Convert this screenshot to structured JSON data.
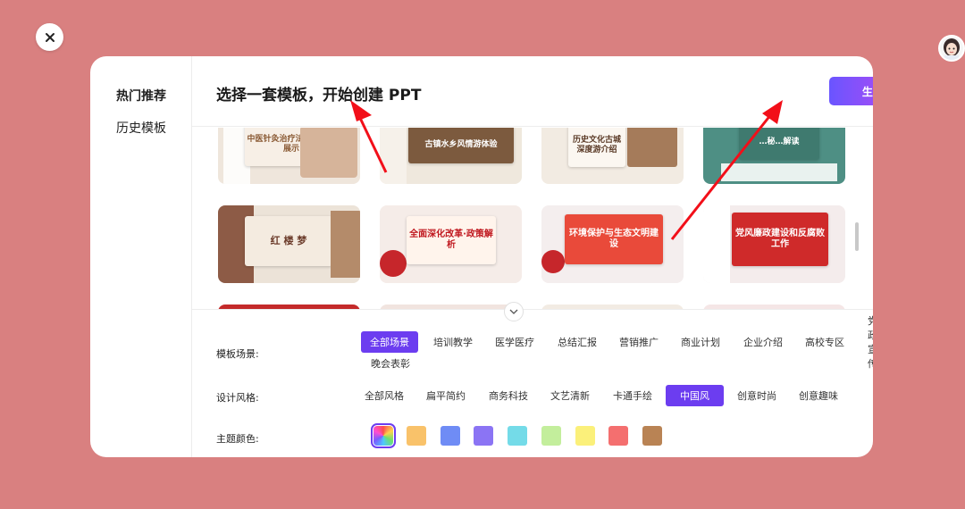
{
  "sidebar": {
    "items": [
      {
        "label": "热门推荐"
      },
      {
        "label": "历史模板"
      }
    ]
  },
  "header": {
    "title": "选择一套模板，开始创建 PPT",
    "generate_label": "生成PPT"
  },
  "templates": [
    {
      "caption": "中医针灸治疗法及其疗效展示"
    },
    {
      "caption": "古镇水乡风情游体验"
    },
    {
      "caption": "历史文化古城深度游介绍"
    },
    {
      "caption": "…秘…解读"
    },
    {
      "caption": "红 楼 梦"
    },
    {
      "caption": "全面深化改革·政策解析"
    },
    {
      "caption": "环境保护与生态文明建设"
    },
    {
      "caption": "党风廉政建设和反腐败工作"
    }
  ],
  "filters": {
    "scene": {
      "label": "模板场景:",
      "options": [
        "全部场景",
        "培训教学",
        "医学医疗",
        "总结汇报",
        "营销推广",
        "商业计划",
        "企业介绍",
        "高校专区",
        "党政宣传",
        "晚会表彰"
      ]
    },
    "style": {
      "label": "设计风格:",
      "options": [
        "全部风格",
        "扁平简约",
        "商务科技",
        "文艺清新",
        "卡通手绘",
        "中国风",
        "创意时尚",
        "创意趣味"
      ]
    },
    "color": {
      "label": "主题颜色:",
      "swatches": [
        "rainbow",
        "#f9c26a",
        "#6f8cf5",
        "#8b74f4",
        "#74dbe8",
        "#c3ee9c",
        "#fbf07a",
        "#f46f6f",
        "#b98354"
      ]
    }
  },
  "colors": {
    "accent": "#6c3df0",
    "background": "#d98080",
    "arrow": "#f20f19"
  }
}
